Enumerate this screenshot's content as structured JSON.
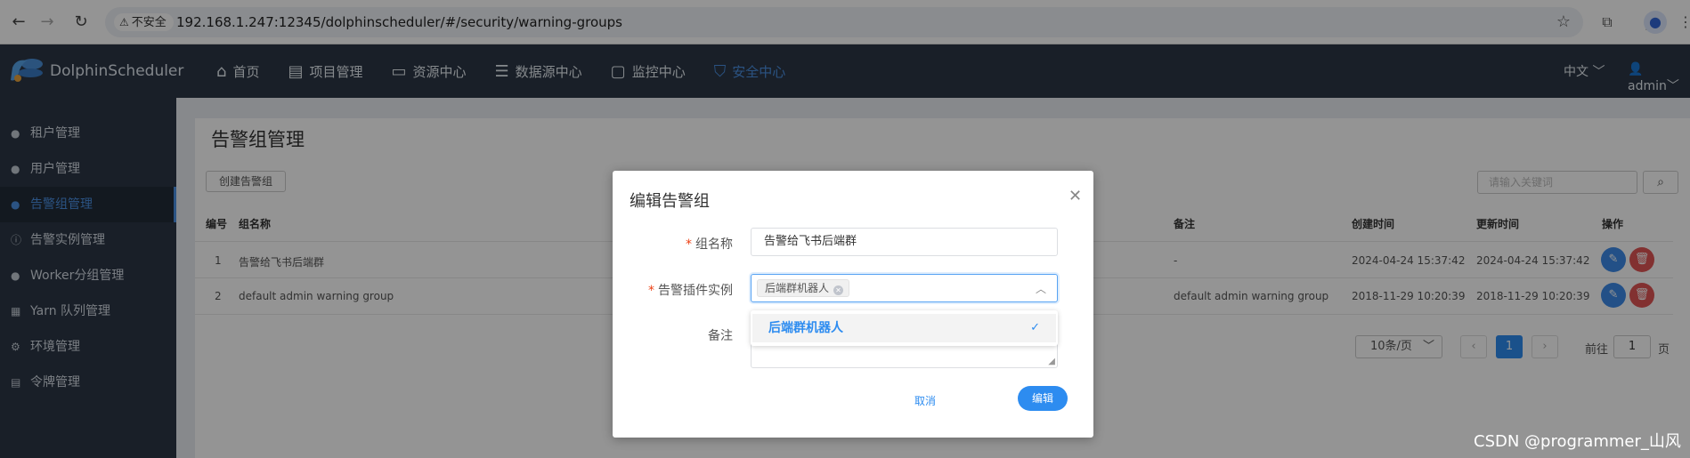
{
  "browser": {
    "insecure_label": "不安全",
    "url": "192.168.1.247:12345/dolphinscheduler/#/security/warning-groups"
  },
  "app": {
    "logo_text": "DolphinScheduler",
    "nav": [
      {
        "label": "首页",
        "icon": "home-icon"
      },
      {
        "label": "项目管理",
        "icon": "document-icon"
      },
      {
        "label": "资源中心",
        "icon": "folder-icon"
      },
      {
        "label": "数据源中心",
        "icon": "database-icon"
      },
      {
        "label": "监控中心",
        "icon": "monitor-icon"
      },
      {
        "label": "安全中心",
        "icon": "shield-icon",
        "active": true
      }
    ],
    "language": "中文",
    "user": "admin",
    "accent_color": "#4a90e2"
  },
  "sidebar": {
    "items": [
      {
        "label": "租户管理",
        "icon": "user-icon"
      },
      {
        "label": "用户管理",
        "icon": "user-icon"
      },
      {
        "label": "告警组管理",
        "icon": "alert-icon",
        "active": true
      },
      {
        "label": "告警实例管理",
        "icon": "info-icon"
      },
      {
        "label": "Worker分组管理",
        "icon": "user-icon"
      },
      {
        "label": "Yarn 队列管理",
        "icon": "grid-icon"
      },
      {
        "label": "环境管理",
        "icon": "gear-icon"
      },
      {
        "label": "令牌管理",
        "icon": "document-icon"
      }
    ]
  },
  "page": {
    "title": "告警组管理",
    "create_button": "创建告警组",
    "search_placeholder": "请输入关键词"
  },
  "table": {
    "headers": {
      "id": "编号",
      "name": "组名称",
      "remark": "备注",
      "created": "创建时间",
      "updated": "更新时间",
      "ops": "操作"
    },
    "rows": [
      {
        "id": "1",
        "name": "告警给飞书后端群",
        "remark": "-",
        "created": "2024-04-24 15:37:42",
        "updated": "2024-04-24 15:37:42"
      },
      {
        "id": "2",
        "name": "default admin warning group",
        "remark": "default admin warning group",
        "created": "2018-11-29 10:20:39",
        "updated": "2018-11-29 10:20:39"
      }
    ]
  },
  "pagination": {
    "page_size": "10条/页",
    "current_page": "1",
    "goto_prefix": "前往",
    "goto_value": "1",
    "goto_suffix": "页"
  },
  "modal": {
    "title": "编辑告警组",
    "required_mark": "*",
    "name_label": "组名称",
    "name_value": "告警给飞书后端群",
    "instance_label": "告警插件实例",
    "selected_tag": "后端群机器人",
    "dropdown_option": "后端群机器人",
    "remark_label": "备注",
    "cancel": "取消",
    "submit": "编辑"
  },
  "watermark": "CSDN @programmer_山风"
}
